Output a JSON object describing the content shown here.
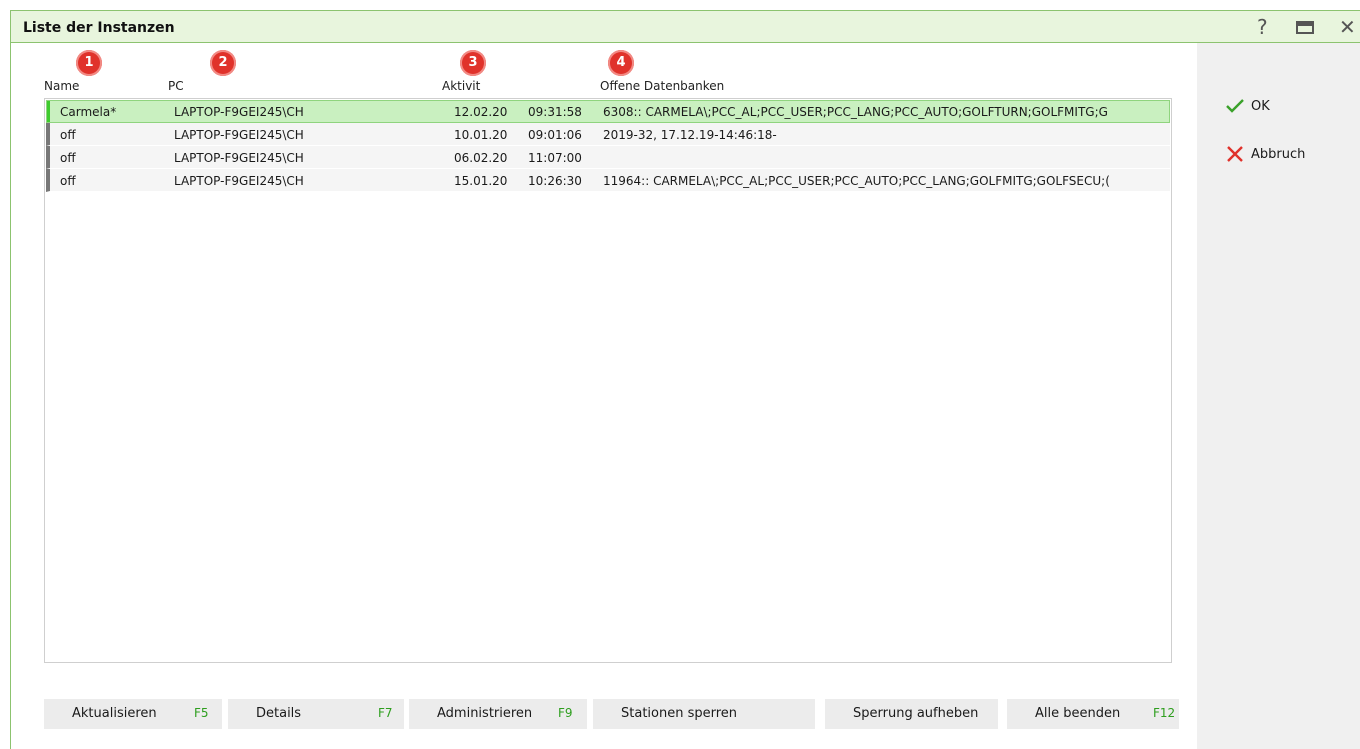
{
  "window": {
    "title": "Liste der Instanzen",
    "controls": {
      "help": "?",
      "close": "✕"
    }
  },
  "columns": [
    "Name",
    "PC",
    "Aktivit",
    "Offene Datenbanken"
  ],
  "badges": [
    "1",
    "2",
    "3",
    "4"
  ],
  "rows": [
    {
      "name": "Carmela*",
      "pc": "LAPTOP-F9GEI245\\CH",
      "date": "12.02.20",
      "time": "09:31:58",
      "db": "6308:: CARMELA\\;PCC_AL;PCC_USER;PCC_LANG;PCC_AUTO;GOLFTURN;GOLFMITG;G",
      "selected": true
    },
    {
      "name": "off",
      "pc": "LAPTOP-F9GEI245\\CH",
      "date": "10.01.20",
      "time": "09:01:06",
      "db": "2019-32, 17.12.19-14:46:18-",
      "selected": false
    },
    {
      "name": "off",
      "pc": "LAPTOP-F9GEI245\\CH",
      "date": "06.02.20",
      "time": "11:07:00",
      "db": "",
      "selected": false
    },
    {
      "name": "off",
      "pc": "LAPTOP-F9GEI245\\CH",
      "date": "15.01.20",
      "time": "10:26:30",
      "db": "11964:: CARMELA\\;PCC_AL;PCC_USER;PCC_AUTO;PCC_LANG;GOLFMITG;GOLFSECU;(",
      "selected": false
    }
  ],
  "side": {
    "ok": "OK",
    "cancel": "Abbruch"
  },
  "buttons": [
    {
      "label": "Aktualisieren",
      "key": "F5"
    },
    {
      "label": "Details",
      "key": "F7"
    },
    {
      "label": "Administrieren",
      "key": "F9"
    },
    {
      "label": "Stationen sperren",
      "key": ""
    },
    {
      "label": "Sperrung aufheben",
      "key": ""
    },
    {
      "label": "Alle beenden",
      "key": "F12"
    }
  ],
  "colors": {
    "accent_green": "#8cc36f",
    "selected_row": "#c9f0c0",
    "badge_red": "#e0322b",
    "hotkey_green": "#2e9e1e"
  },
  "icons": {
    "ok": "checkmark-icon",
    "cancel": "cross-icon",
    "help": "question-icon",
    "maximize": "maximize-icon",
    "close": "close-icon"
  }
}
